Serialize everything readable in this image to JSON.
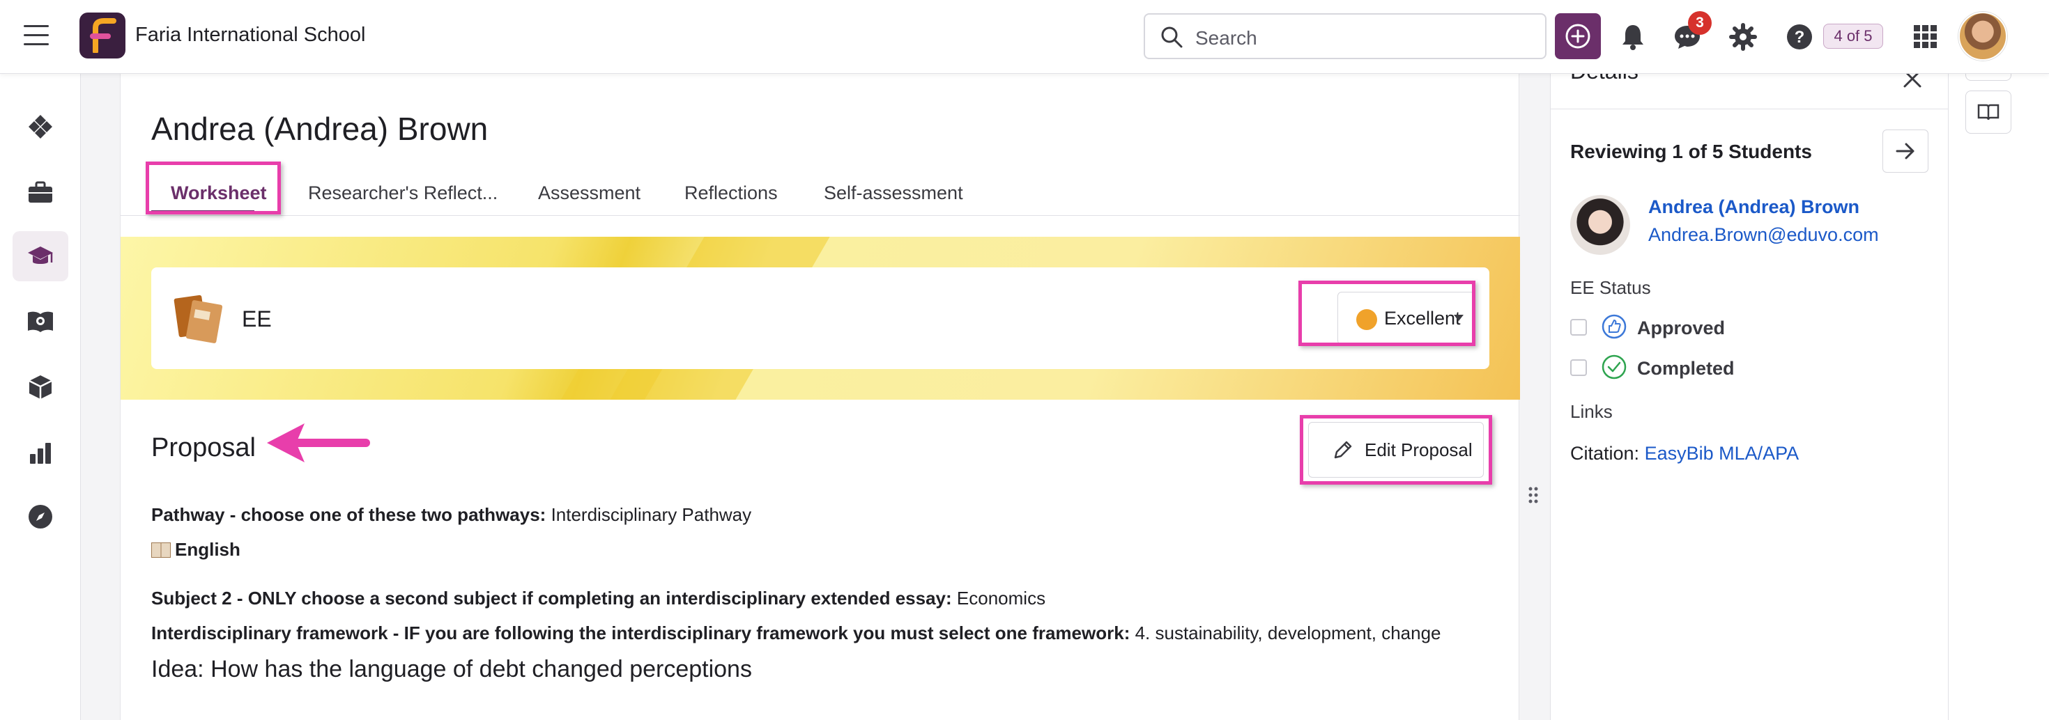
{
  "header": {
    "school_name": "Faria International School",
    "search_placeholder": "Search",
    "notification_count": "3",
    "progress_label": "4 of 5",
    "accent_color": "#6b2f6a"
  },
  "sidebar": {
    "items": [
      {
        "icon": "dashboard-icon"
      },
      {
        "icon": "briefcase-icon"
      },
      {
        "icon": "graduation-cap-icon",
        "active": true
      },
      {
        "icon": "book-icon"
      },
      {
        "icon": "cube-icon"
      },
      {
        "icon": "bar-chart-icon"
      },
      {
        "icon": "compass-icon"
      }
    ]
  },
  "main": {
    "student_name": "Andrea (Andrea) Brown",
    "tabs": [
      {
        "label": "Worksheet",
        "active": true
      },
      {
        "label": "Researcher's Reflect..."
      },
      {
        "label": "Assessment"
      },
      {
        "label": "Reflections"
      },
      {
        "label": "Self-assessment"
      }
    ],
    "ee_label": "EE",
    "grade_value": "Excellent",
    "proposal_heading": "Proposal",
    "edit_button": "Edit Proposal",
    "fields": {
      "pathway_label": "Pathway - choose one of these two pathways:",
      "pathway_value": "Interdisciplinary Pathway",
      "subject1_value": "English",
      "subject2_label": "Subject 2 - ONLY choose a second subject if completing an interdisciplinary extended essay:",
      "subject2_value": "Economics",
      "framework_label": "Interdisciplinary framework - IF you are following the interdisciplinary framework you must select one framework:",
      "framework_value": "4. sustainability, development, change"
    },
    "idea": "Idea: How has the language of debt changed perceptions"
  },
  "details": {
    "title": "Details",
    "reviewing": "Reviewing 1 of 5 Students",
    "student_name": "Andrea (Andrea) Brown",
    "student_email": "Andrea.Brown@eduvo.com",
    "status_heading": "EE Status",
    "statuses": [
      {
        "label": "Approved",
        "checked": false
      },
      {
        "label": "Completed",
        "checked": false
      }
    ],
    "links_heading": "Links",
    "citation_label": "Citation:",
    "citation_link": "EasyBib MLA/APA"
  }
}
